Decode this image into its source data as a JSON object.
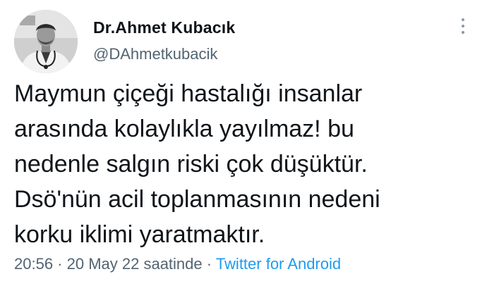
{
  "author": {
    "display_name": "Dr.Ahmet Kubacık",
    "handle": "@DAhmetkubacik",
    "avatar_icon": "profile-photo"
  },
  "menu": {
    "icon": "more-vertical-icon"
  },
  "tweet": {
    "text": "Maymun çiçeği hastalığı insanlar\narasında kolaylıkla yayılmaz! bu\nnedenle salgın riski çok düşüktür.\nDsö'nün  acil toplanmasının nedeni\nkorku iklimi yaratmaktır."
  },
  "meta": {
    "time": "20:56",
    "separator_1": " · ",
    "date": "20 May 22 saatinde",
    "separator_2": " · ",
    "source": "Twitter for Android"
  },
  "colors": {
    "text": "#0f1419",
    "secondary": "#536471",
    "link": "#1d9bf0"
  }
}
